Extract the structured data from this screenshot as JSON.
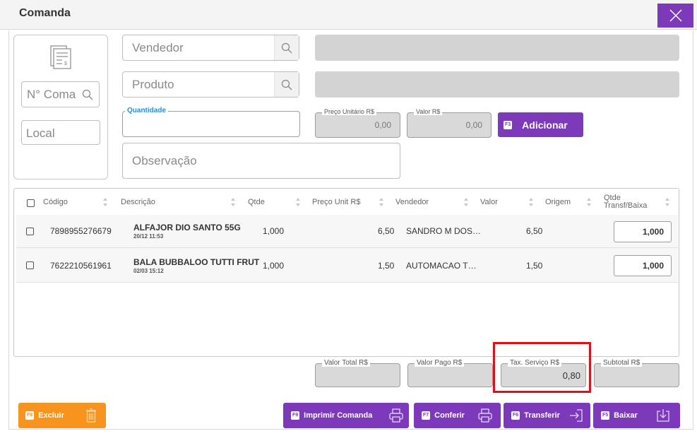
{
  "window": {
    "title": "Comanda"
  },
  "left_panel": {
    "comanda_placeholder": "N° Comanda",
    "local_placeholder": "Local"
  },
  "form": {
    "vendedor_placeholder": "Vendedor",
    "produto_placeholder": "Produto",
    "quantidade_label": "Quantidade",
    "preco_unitario_label": "Preço Unitário R$",
    "preco_unitario_value": "0,00",
    "valor_label": "Valor R$",
    "valor_value": "0,00",
    "adicionar_key": "F3",
    "adicionar_label": "Adicionar",
    "observacao_placeholder": "Observação"
  },
  "table": {
    "headers": {
      "codigo": "Código",
      "descricao": "Descrição",
      "qtde": "Qtde",
      "preco_unit": "Preço Unit R$",
      "vendedor": "Vendedor",
      "valor": "Valor",
      "origem": "Origem",
      "qtde_transf_1": "Qtde",
      "qtde_transf_2": "Transf/Baixa"
    },
    "rows": [
      {
        "codigo": "7898955276679",
        "descricao": "ALFAJOR DIO SANTO 55G",
        "data": "20/12 11:53",
        "qtde": "1,000",
        "preco": "6,50",
        "vendedor": "SANDRO M DOS…",
        "valor": "6,50",
        "origem": "",
        "qtde_transf": "1,000"
      },
      {
        "codigo": "7622210561961",
        "descricao": "BALA BUBBALOO TUTTI FRUT",
        "data": "02/03 15:12",
        "qtde": "1,000",
        "preco": "1,50",
        "vendedor": "AUTOMACAO T…",
        "valor": "1,50",
        "origem": "",
        "qtde_transf": "1,000"
      }
    ]
  },
  "totals": {
    "valor_total_label": "Valor Total R$",
    "valor_total_value": "",
    "valor_pago_label": "Valor Pago R$",
    "valor_pago_value": "",
    "tax_servico_label": "Tax. Serviço R$",
    "tax_servico_value": "0,80",
    "subtotal_label": "Subtotal R$",
    "subtotal_value": ""
  },
  "actions": {
    "excluir_key": "F8",
    "excluir_label": "Excluir",
    "imprimir_key": "F9",
    "imprimir_label": "Imprimir Comanda",
    "conferir_key": "F7",
    "conferir_label": "Conferir",
    "transferir_key": "F6",
    "transferir_label": "Transferir",
    "baixar_key": "F5",
    "baixar_label": "Baixar"
  },
  "colors": {
    "accent": "#7c3aba",
    "excluir": "#f7941d",
    "highlight": "#e0101a"
  }
}
